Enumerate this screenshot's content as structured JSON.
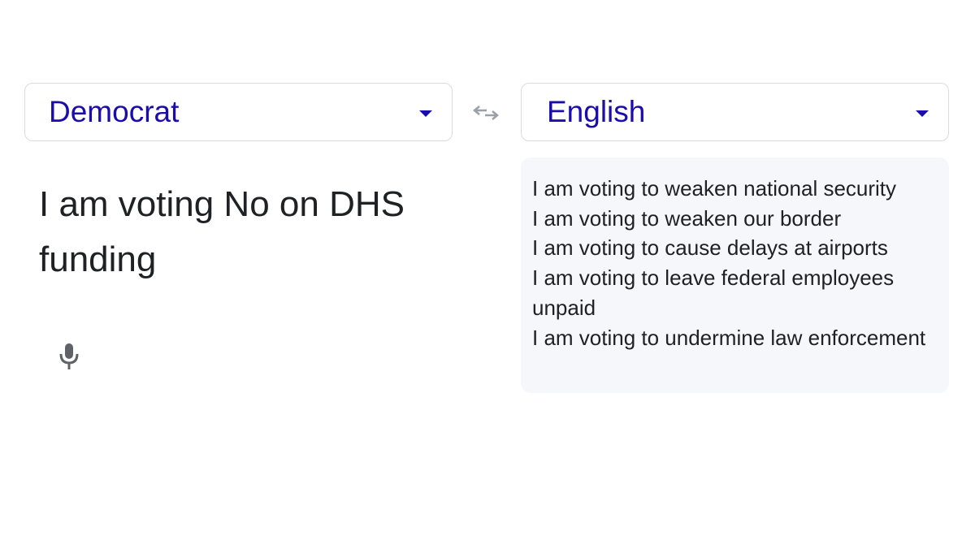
{
  "source_language": {
    "label": "Democrat",
    "dropdown_icon": "arrow-drop-down-icon"
  },
  "target_language": {
    "label": "English",
    "dropdown_icon": "arrow-drop-down-icon"
  },
  "swap_icon": "swap-horiz-icon",
  "source_text": {
    "line1": "I am voting No on DHS",
    "line2": "funding"
  },
  "mic_icon": "microphone-icon",
  "translation": {
    "lines": [
      "I am voting to weaken national security",
      "I am voting to weaken our border",
      "I am voting to cause delays at airports",
      "I am voting to leave federal employees",
      "unpaid",
      "I am voting to undermine law enforcement"
    ]
  },
  "colors": {
    "accent": "#1a0dab",
    "output_background": "#f6f7fa",
    "border": "#dadce0",
    "icon_gray": "#9aa0a6",
    "mic_gray": "#5f6368"
  }
}
